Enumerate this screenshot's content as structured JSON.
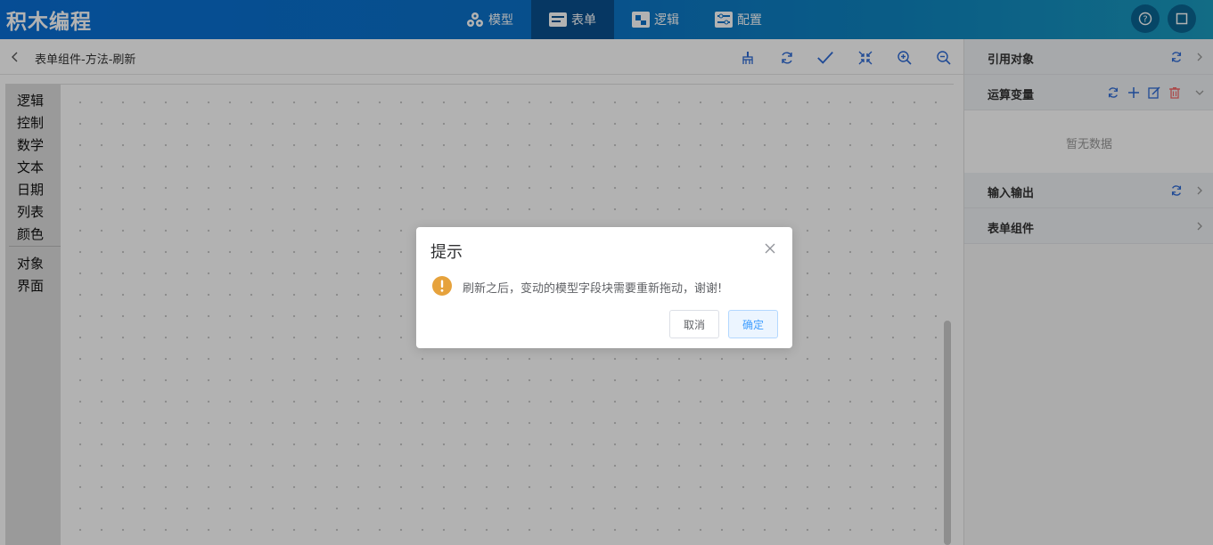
{
  "app": {
    "brand": "积木编程"
  },
  "nav": {
    "items": [
      {
        "label": "模型",
        "icon": "model-icon"
      },
      {
        "label": "表单",
        "icon": "form-icon",
        "active": true
      },
      {
        "label": "逻辑",
        "icon": "logic-icon"
      },
      {
        "label": "配置",
        "icon": "config-icon"
      }
    ]
  },
  "header": {
    "breadcrumb": "表单组件-方法-刷新"
  },
  "toolbox": {
    "categories": [
      "逻辑",
      "控制",
      "数学",
      "文本",
      "日期",
      "列表",
      "颜色",
      "对象",
      "界面"
    ]
  },
  "right_panel": {
    "sections": [
      {
        "title": "引用对象"
      },
      {
        "title": "运算变量",
        "empty_text": "暂无数据"
      },
      {
        "title": "输入输出"
      },
      {
        "title": "表单组件"
      }
    ]
  },
  "dialog": {
    "title": "提示",
    "message": "刷新之后，变动的模型字段块需要重新拖动，谢谢!",
    "cancel_label": "取消",
    "confirm_label": "确定"
  },
  "colors": {
    "accent": "#409eff",
    "warning": "#e6a23c",
    "danger": "#f56c6c",
    "icon_blue": "#2d6ad6"
  }
}
